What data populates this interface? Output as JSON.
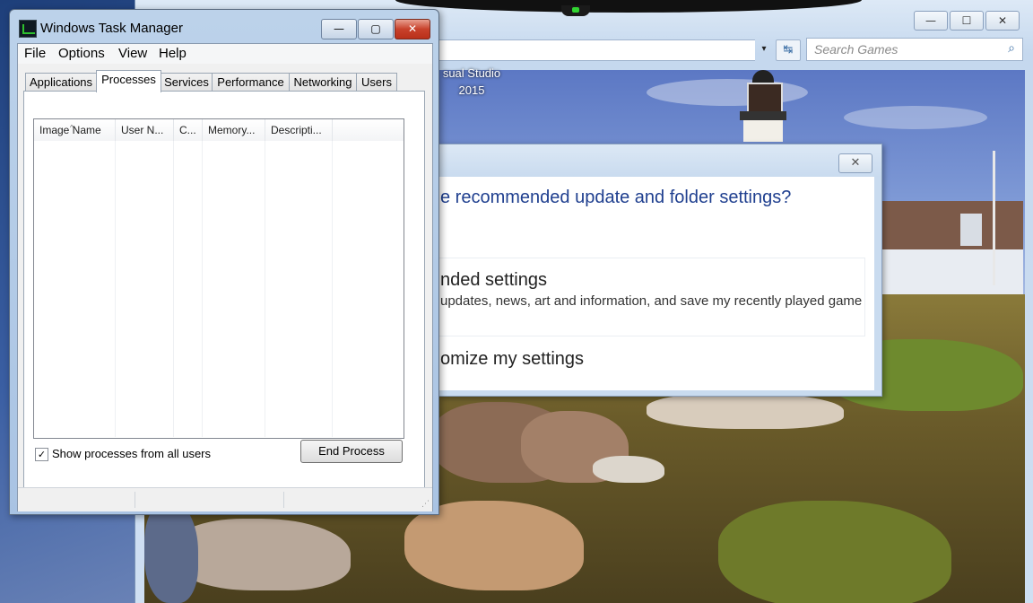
{
  "games_window": {
    "search_placeholder": "Search Games",
    "caption_minimize": "—",
    "caption_maximize": "☐",
    "caption_close": "✕",
    "dropdown_glyph": "▾",
    "refresh_glyph": "↹",
    "search_glyph": "⌕",
    "background_text_line1": "sual Studio",
    "background_text_line2": "2015"
  },
  "settings_dialog": {
    "close_glyph": "✕",
    "question": "e recommended update and folder settings?",
    "option1_title": "nded settings",
    "option1_desc": "updates, news, art and information, and save my recently played game",
    "option2_title": "omize my settings"
  },
  "task_manager": {
    "title": "Windows Task Manager",
    "caption_minimize": "—",
    "caption_maximize": "▢",
    "caption_close": "✕",
    "menu": [
      "File",
      "Options",
      "View",
      "Help"
    ],
    "tabs": [
      "Applications",
      "Processes",
      "Services",
      "Performance",
      "Networking",
      "Users"
    ],
    "active_tab": "Processes",
    "columns": [
      "Image Name",
      "User N...",
      "C...",
      "Memory...",
      "Descripti..."
    ],
    "sort_glyph": "^",
    "show_all_label": "Show processes from all users",
    "show_all_checked": "✓",
    "end_process_label": "End Process",
    "grip_glyph": "⋰"
  }
}
